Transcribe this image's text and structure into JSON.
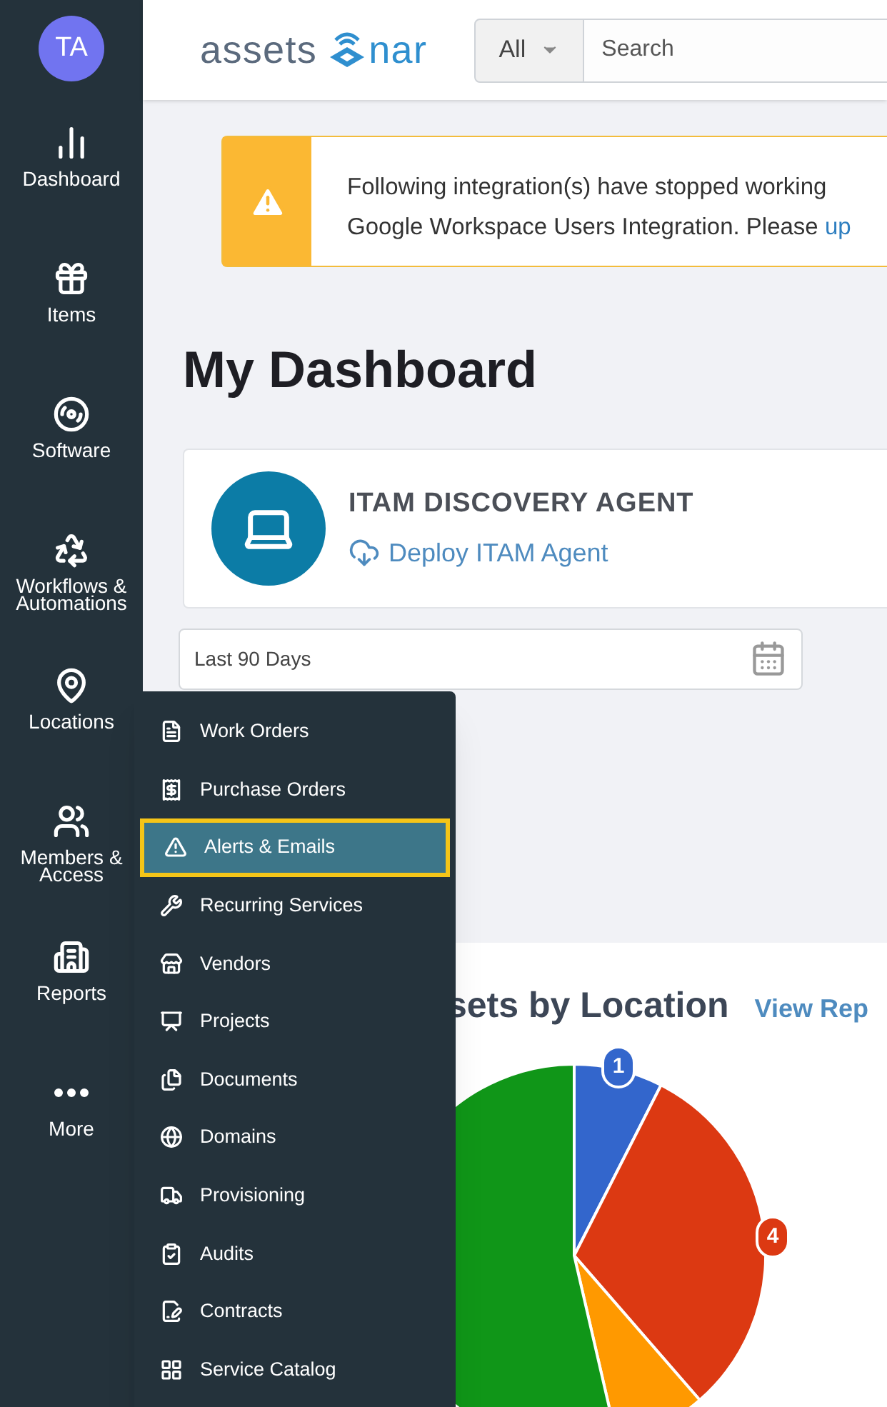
{
  "user": {
    "initials": "TA"
  },
  "logo": {
    "left": "assets",
    "right": "nar"
  },
  "search": {
    "scope": "All",
    "placeholder": "Search"
  },
  "nav": [
    {
      "label": "Dashboard"
    },
    {
      "label": "Items"
    },
    {
      "label": "Software"
    },
    {
      "label": "Workflows & Automations"
    },
    {
      "label": "Locations"
    },
    {
      "label": "Members & Access"
    },
    {
      "label": "Reports"
    },
    {
      "label": "More"
    }
  ],
  "alert": {
    "line1": "Following integration(s) have stopped working",
    "line2": "Google Workspace Users Integration. Please ",
    "link": "up"
  },
  "page_title": "My Dashboard",
  "agent_card": {
    "title": "ITAM DISCOVERY AGENT",
    "link": "Deploy ITAM Agent"
  },
  "date_range": {
    "value": "Last 90 Days"
  },
  "menu": [
    {
      "label": "Work Orders",
      "selected": false
    },
    {
      "label": "Purchase Orders",
      "selected": false
    },
    {
      "label": "Alerts & Emails",
      "selected": true
    },
    {
      "label": "Recurring Services",
      "selected": false
    },
    {
      "label": "Vendors",
      "selected": false
    },
    {
      "label": "Projects",
      "selected": false
    },
    {
      "label": "Documents",
      "selected": false
    },
    {
      "label": "Domains",
      "selected": false
    },
    {
      "label": "Provisioning",
      "selected": false
    },
    {
      "label": "Audits",
      "selected": false
    },
    {
      "label": "Contracts",
      "selected": false
    },
    {
      "label": "Service Catalog",
      "selected": false
    }
  ],
  "location_panel": {
    "title": "sets by Location",
    "link": "View Rep",
    "slice_labels": [
      {
        "text": "1",
        "color": "#3366cc"
      },
      {
        "text": "4",
        "color": "#dc3912"
      }
    ]
  }
}
